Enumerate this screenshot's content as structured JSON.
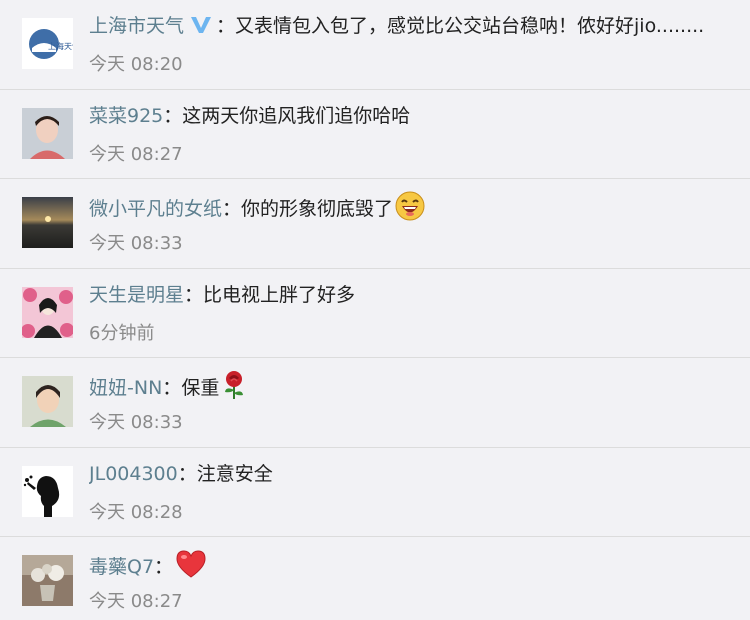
{
  "comments": [
    {
      "username": "上海市天气",
      "verified": true,
      "colon": "：",
      "text": "又表情包入包了，感觉比公交站台稳呐！侬好好jio........",
      "time": "今天 08:20",
      "avatar": "shanghai-weather-logo",
      "avatar_logo_text": "上海天气"
    },
    {
      "username": "菜菜925",
      "colon": "：",
      "text": "这两天你追风我们追你哈哈",
      "time": "今天 08:27",
      "avatar": "girl-portrait"
    },
    {
      "username": "微小平凡的女纸",
      "colon": "：",
      "text": "你的形象彻底毁了",
      "emoji": "laughing-face-emoji",
      "time": "今天 08:33",
      "avatar": "sunset-landscape"
    },
    {
      "username": "天生是明星",
      "colon": "：",
      "text": "比电视上胖了好多",
      "time": "6分钟前",
      "avatar": "pink-floral-figure"
    },
    {
      "username": "妞妞-NN",
      "colon": "：",
      "text": "保重",
      "emoji": "rose-emoji",
      "time": "今天 08:33",
      "avatar": "woman-portrait"
    },
    {
      "username": "JL004300",
      "colon": "：",
      "text": "注意安全",
      "time": "今天 08:28",
      "avatar": "silhouette-blowing"
    },
    {
      "username": "毒藥Q7",
      "colon": "：",
      "text": "",
      "emoji": "red-heart-emoji",
      "time": "今天 08:27",
      "avatar": "flower-vase"
    }
  ],
  "colors": {
    "username": "#5d7f8f",
    "text": "#222222",
    "time": "#8a8a8a",
    "background": "#f2f2f5",
    "divider": "#dcdcdc",
    "verified": "#6db5f0"
  }
}
